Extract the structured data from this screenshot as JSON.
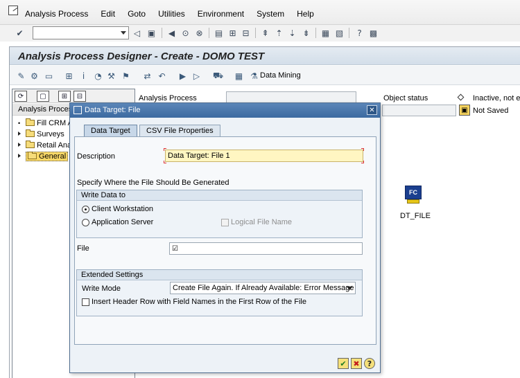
{
  "menu": {
    "items": [
      "Analysis Process",
      "Edit",
      "Goto",
      "Utilities",
      "Environment",
      "System",
      "Help"
    ]
  },
  "toolbar": {
    "command_field": "",
    "icons": [
      "enter-icon",
      "back-icon",
      "save-icon",
      "exit-icon",
      "cancel-icon",
      "print-icon",
      "find-icon",
      "find-next-icon",
      "first-page-icon",
      "previous-page-icon",
      "next-page-icon",
      "last-page-icon",
      "create-session-icon",
      "shortcut-icon",
      "help-icon",
      "layout-icon"
    ]
  },
  "screen": {
    "title": "Analysis Process Designer - Create - DOMO TEST",
    "data_mining_label": "Data Mining"
  },
  "tree": {
    "header": "Analysis Process",
    "items": [
      {
        "label": "Fill CRM A",
        "selected": false
      },
      {
        "label": "Surveys",
        "selected": false
      },
      {
        "label": "Retail Ana",
        "selected": false
      },
      {
        "label": "General",
        "selected": true
      }
    ]
  },
  "header_fields": {
    "analysis_process_label": "Analysis Process",
    "object_status_label": "Object status",
    "status_text": "Inactive, not e",
    "save_status": "Not Saved"
  },
  "canvas": {
    "node_icon_text": "FC",
    "node_label": "DT_FILE"
  },
  "dialog": {
    "title": "Data Target: File",
    "tabs": [
      {
        "label": "Data Target",
        "active": true
      },
      {
        "label": "CSV File Properties",
        "active": false
      }
    ],
    "description_label": "Description",
    "description_value": "Data Target: File 1",
    "specify_text": "Specify Where the File Should Be Generated",
    "write_group_title": "Write Data to",
    "radio_client": "Client Workstation",
    "radio_server": "Application Server",
    "logical_file_label": "Logical File Name",
    "file_label": "File",
    "file_value": "",
    "extended_title": "Extended Settings",
    "write_mode_label": "Write Mode",
    "write_mode_value": "Create File Again. If Already Available: Error Message",
    "header_row_label": "Insert Header Row with Field Names in the First Row of the File",
    "selected_write_target": "Client Workstation",
    "logical_file_checked": false,
    "header_row_checked": false
  }
}
